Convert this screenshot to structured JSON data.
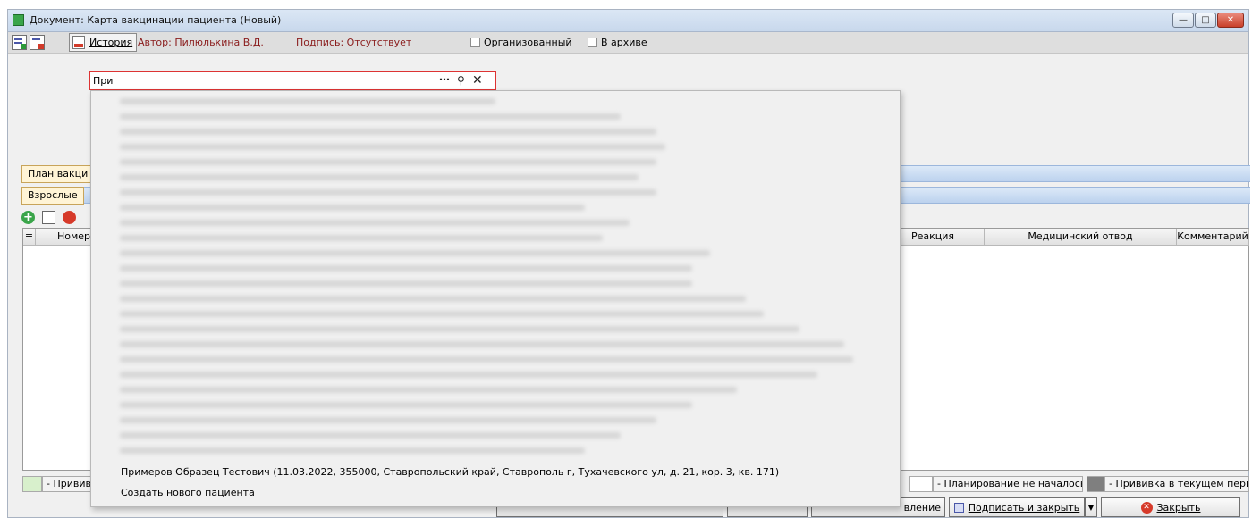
{
  "window": {
    "title": "Документ: Карта вакцинации пациента (Новый)"
  },
  "toolbar": {
    "history_label": "История",
    "author": "Автор: Пилюлькина В.Д.",
    "signature": "Подпись: Отсутствует",
    "organized_label": "Организованный",
    "archive_label": "В архиве"
  },
  "tabs": {
    "plan": "План вакци",
    "adults": "Взрослые"
  },
  "grid": {
    "columns": {
      "number": "Номер",
      "reaction": "Реакция",
      "med_exemption": "Медицинский отвод",
      "comment": "Комментарий"
    }
  },
  "legend": {
    "item1": "- Привив",
    "planning_not_started": "- Планирование не началось",
    "current_period": "- Прививка в текущем пери..."
  },
  "buttons": {
    "partial_send": "вление",
    "sign_close": "Подписать и закрыть",
    "close": "Закрыть"
  },
  "search": {
    "value": "При",
    "more_icon": "ellipsis-icon",
    "search_icon": "search-icon",
    "clear_icon": "close-icon"
  },
  "dropdown": {
    "patient_result": "Примеров Образец Тестович (11.03.2022, 355000, Ставропольский край, Ставрополь г, Тухачевского ул, д. 21, кор. 3, кв. 171)",
    "create_new": "Создать нового пациента"
  }
}
